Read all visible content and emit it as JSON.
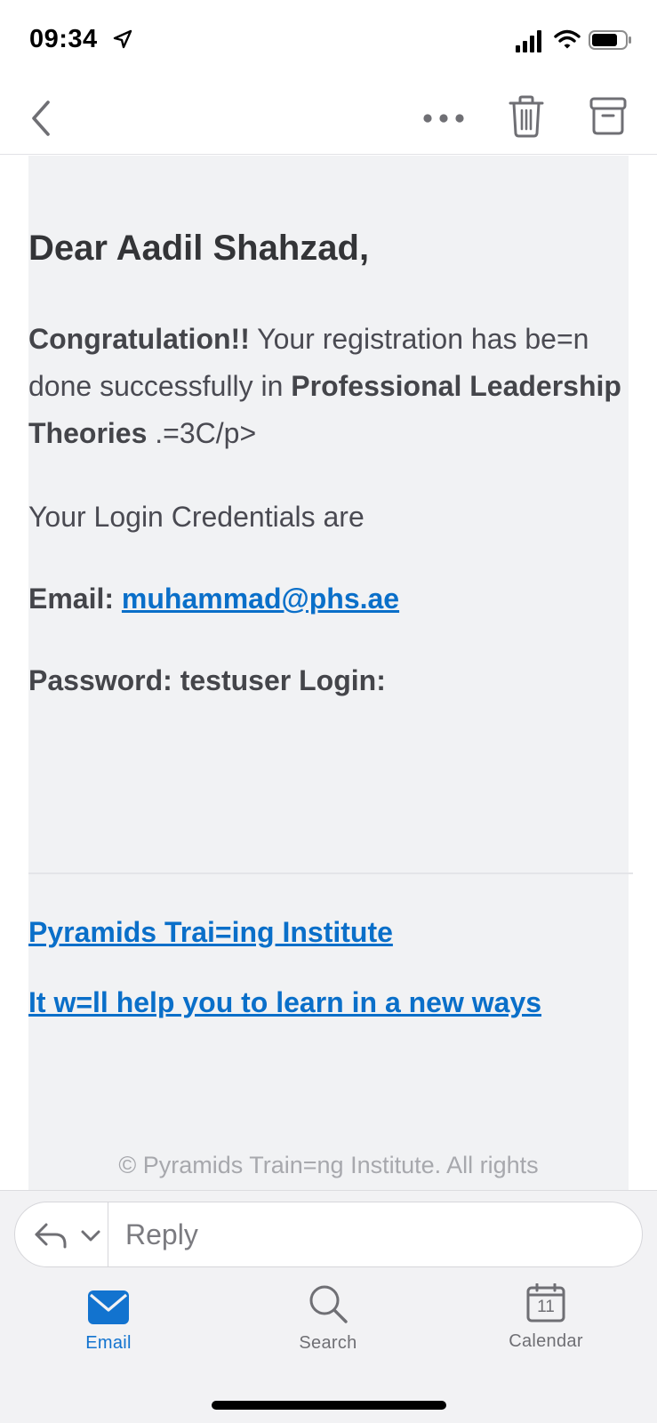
{
  "status_bar": {
    "time": "09:34",
    "icons": [
      "location-arrow-icon",
      "signal-icon",
      "wifi-icon",
      "battery-icon"
    ]
  },
  "toolbar": {
    "icons": [
      "back-icon",
      "more-icon",
      "trash-icon",
      "archive-icon"
    ]
  },
  "email": {
    "greeting": "Dear Aadil Shahzad,",
    "congrats_bold": "Congratulation!!",
    "congrats_text": " Your registration has be=n done successfully in ",
    "course_name": "Professional Leadership Theories",
    "congrats_tail": " .=3C/p>",
    "credentials_intro": "Your Login Credentials are",
    "email_label": "Email: ",
    "email_value": "muhammad@phs.ae",
    "password_line": "Password: testuser Login:",
    "footer_link_1": "Pyramids Trai=ing Institute",
    "footer_link_2": "It w=ll help you to learn in a new ways",
    "copyright": "© Pyramids Train=ng Institute. All rights"
  },
  "reply": {
    "placeholder": "Reply",
    "icons": [
      "reply-arrow-icon",
      "chevron-down-icon"
    ]
  },
  "tabs": [
    {
      "label": "Email",
      "icon": "mail-icon",
      "active": true
    },
    {
      "label": "Search",
      "icon": "search-icon",
      "active": false
    },
    {
      "label": "Calendar",
      "icon": "calendar-icon",
      "active": false,
      "badge": "11"
    }
  ],
  "colors": {
    "accent": "#1273cf",
    "link": "#0a6fc9",
    "email_background": "#f1f2f4"
  }
}
